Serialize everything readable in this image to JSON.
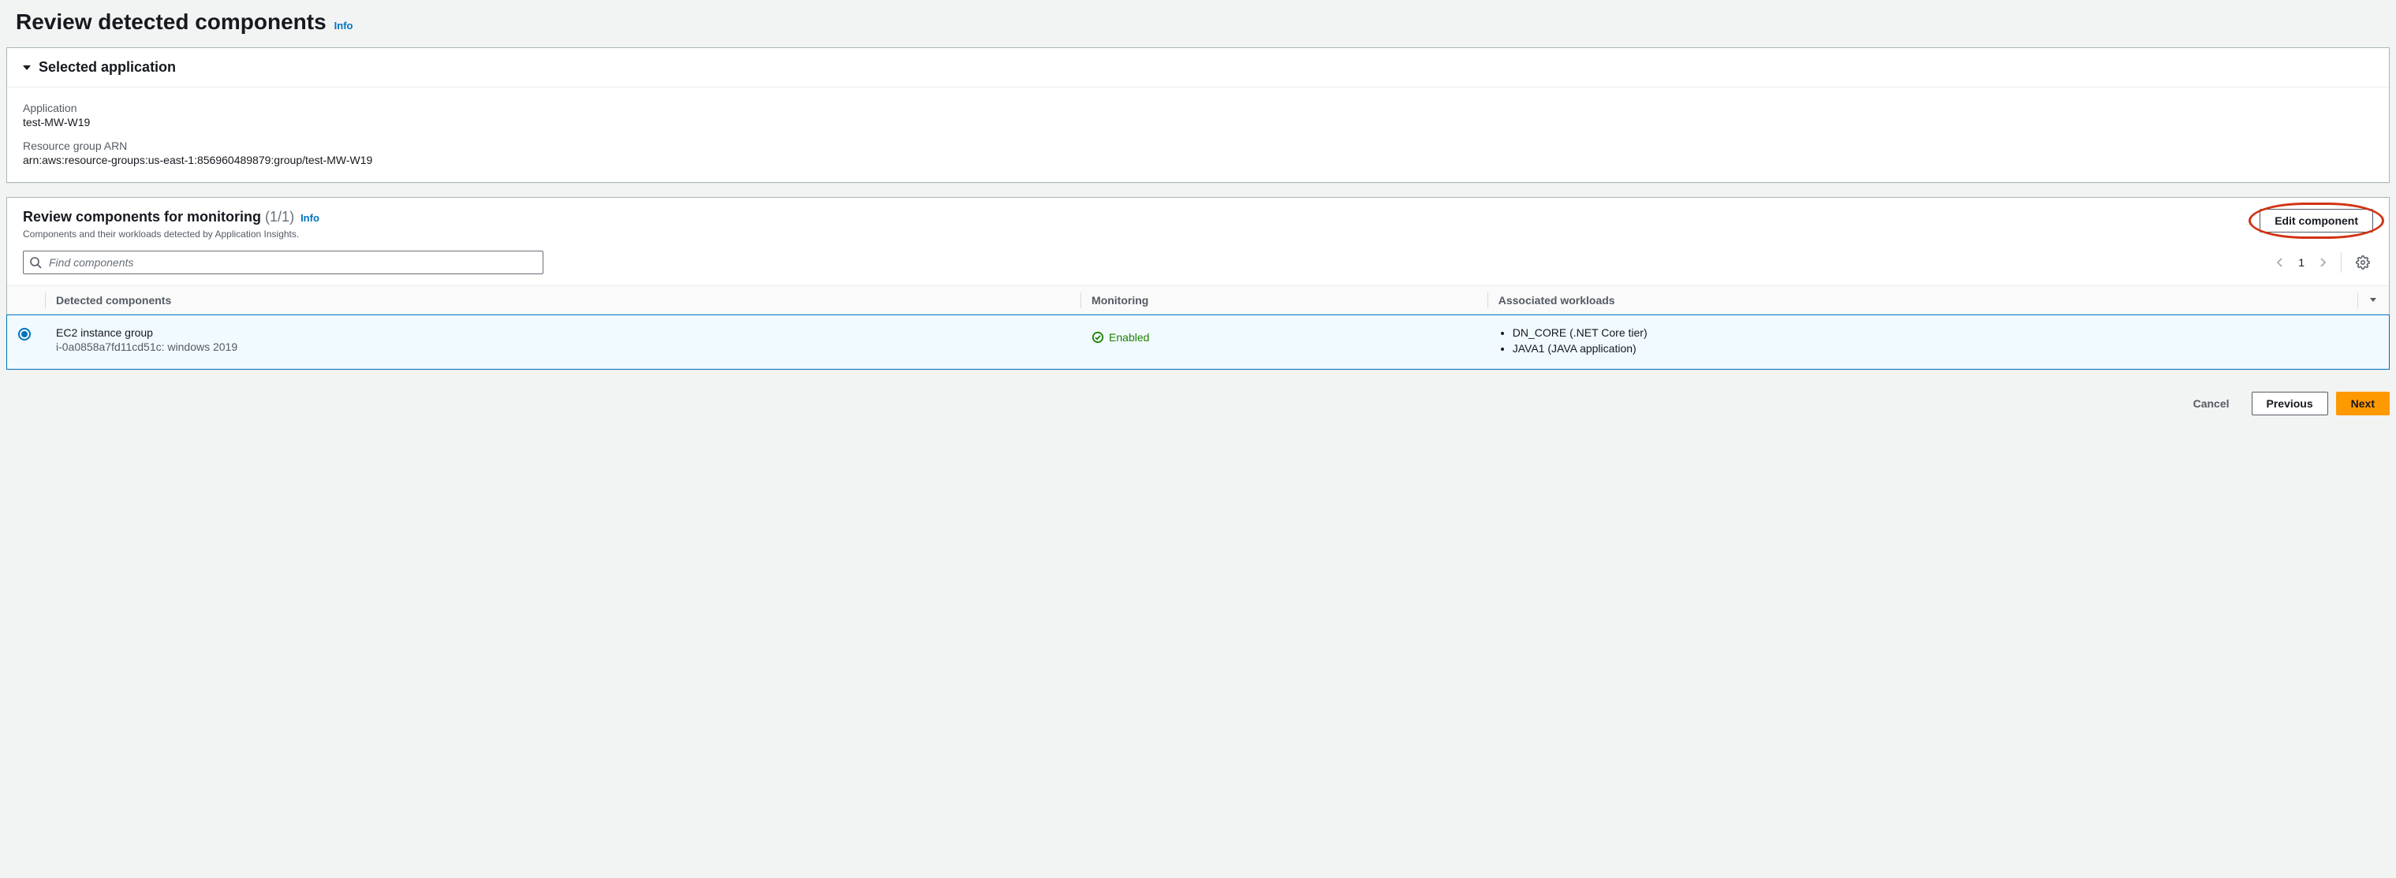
{
  "header": {
    "title": "Review detected components",
    "info": "Info"
  },
  "selected_app": {
    "panel_title": "Selected application",
    "application_label": "Application",
    "application_value": "test-MW-W19",
    "arn_label": "Resource group ARN",
    "arn_value": "arn:aws:resource-groups:us-east-1:856960489879:group/test-MW-W19"
  },
  "review": {
    "title": "Review components for monitoring",
    "counter": "(1/1)",
    "info": "Info",
    "description": "Components and their workloads detected by Application Insights.",
    "edit_button": "Edit component",
    "search_placeholder": "Find components",
    "page_number": "1",
    "columns": {
      "detected": "Detected components",
      "monitoring": "Monitoring",
      "workloads": "Associated workloads"
    },
    "row": {
      "component_title": "EC2 instance group",
      "component_sub": "i-0a0858a7fd11cd51c: windows 2019",
      "monitoring_status": "Enabled",
      "workloads": [
        "DN_CORE (.NET Core tier)",
        "JAVA1 (JAVA application)"
      ]
    }
  },
  "footer": {
    "cancel": "Cancel",
    "previous": "Previous",
    "next": "Next"
  }
}
